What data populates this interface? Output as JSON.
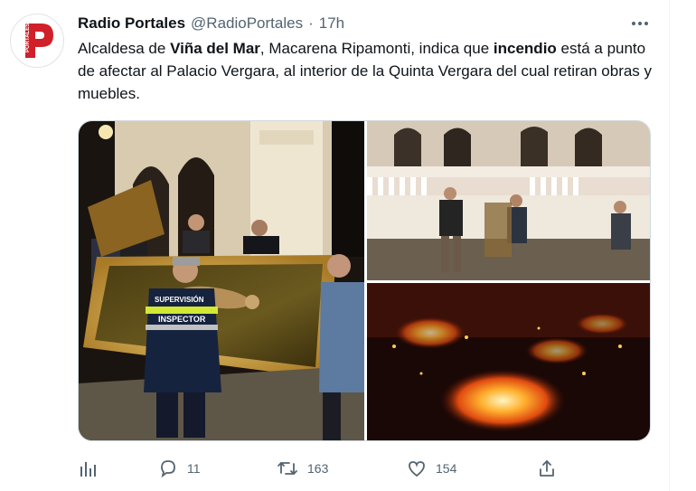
{
  "tweet": {
    "author_name": "Radio Portales",
    "author_handle": "@RadioPortales",
    "separator": "·",
    "time": "17h",
    "text_parts": [
      {
        "text": "Alcaldesa de ",
        "bold": false
      },
      {
        "text": "Viña del Mar",
        "bold": true
      },
      {
        "text": ", Macarena Ripamonti, indica que ",
        "bold": false
      },
      {
        "text": "incendio",
        "bold": true
      },
      {
        "text": " está a punto de afectar al Palacio Vergara, al interior de la Quinta Vergara del cual retiran obras y muebles.",
        "bold": false
      }
    ]
  },
  "avatar": {
    "logo_letter": "P",
    "logo_word": "PORTALES",
    "brand_color": "#d0202a"
  },
  "media": {
    "photo1": {
      "vest_text": [
        "SUPERVISIÓN",
        "INSPECTOR"
      ]
    }
  },
  "actions": {
    "analytics_icon": "bar-chart-icon",
    "reply_count": "11",
    "retweet_count": "163",
    "like_count": "154",
    "share_icon": "share-icon"
  },
  "colors": {
    "text": "#0f1419",
    "secondary": "#536471",
    "border": "#cfd9de"
  }
}
